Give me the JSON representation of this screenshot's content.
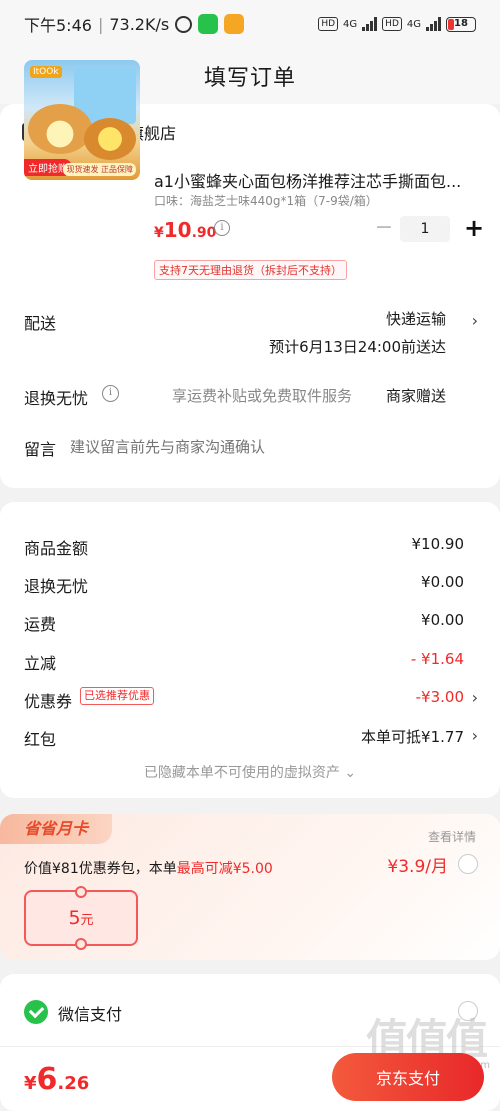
{
  "status_bar": {
    "time": "下午5:46",
    "net_speed": "73.2K/s",
    "hd1": "HD",
    "hd2": "HD",
    "net_type": "4G",
    "battery": "18"
  },
  "nav": {
    "title": "填写订单"
  },
  "shop": {
    "name": "新见福食品旗舰店"
  },
  "product": {
    "title": "a1小蜜蜂夹心面包杨洋推荐注芯手撕面包...",
    "spec": "口味：海盐芝士味440g*1箱（7-9袋/箱）",
    "price_symbol": "¥",
    "price_int": "10",
    "price_dec": ".90",
    "quantity": "1",
    "return_policy": "支持7天无理由退货（拆封后不支持）",
    "image_tag_buy": "立即抢购",
    "image_tag_promo": "现货速发 正品保障"
  },
  "delivery": {
    "label": "配送",
    "method": "快递运输",
    "eta": "预计6月13日24:00前送达"
  },
  "return_service": {
    "label": "退换无忧",
    "desc": "享运费补贴或免费取件服务",
    "gift": "商家赠送"
  },
  "note": {
    "label": "留言",
    "placeholder": "建议留言前先与商家沟通确认"
  },
  "summary": {
    "goods_label": "商品金额",
    "goods_val": "¥10.90",
    "return_label": "退换无忧",
    "return_val": "¥0.00",
    "ship_label": "运费",
    "ship_val": "¥0.00",
    "discount_label": "立减",
    "discount_val": "- ¥1.64",
    "coupon_label": "优惠券",
    "coupon_badge": "已选推荐优惠",
    "coupon_val": "-¥3.00",
    "redpack_label": "红包",
    "redpack_val": "本单可抵¥1.77",
    "hidden_note": "已隐藏本单不可使用的虚拟资产 ⌄"
  },
  "monthly_card": {
    "badge": "省省月卡",
    "detail_link": "查看详情",
    "desc_prefix": "价值¥81优惠券包，本单",
    "desc_highlight": "最高可减¥5.00",
    "price": "¥3.9/月",
    "coupon_num": "5",
    "coupon_unit": "元"
  },
  "payment": {
    "method": "微信支付"
  },
  "bottom": {
    "total_symbol": "¥",
    "total_int": "6",
    "total_dec": ".26",
    "submit_label": "京东支付",
    "watermark": "zhizhizhi.com"
  },
  "colors": {
    "accent": "#f02a2a",
    "wechat_green": "#27c24c"
  }
}
